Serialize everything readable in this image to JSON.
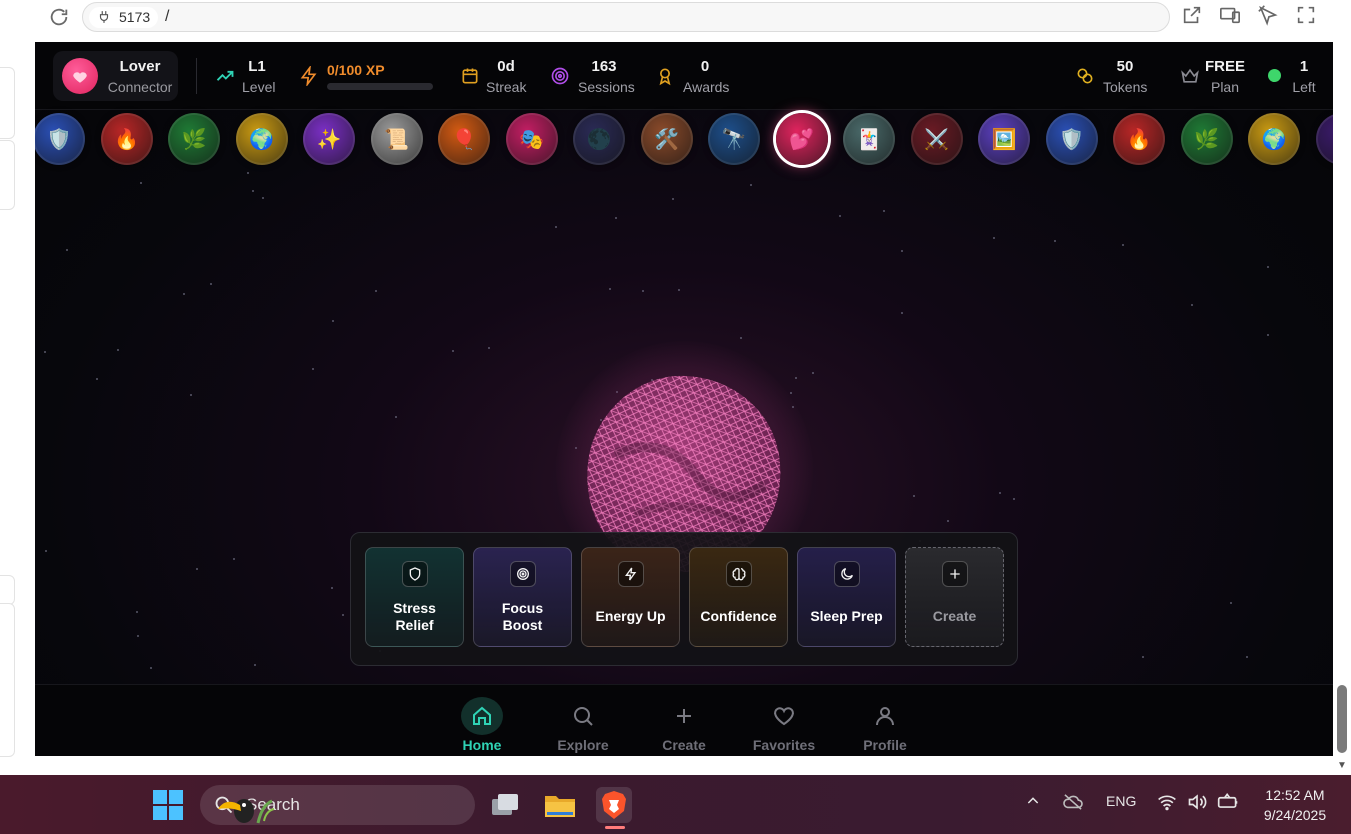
{
  "browser": {
    "port_chip": "5173",
    "path": "/"
  },
  "topstats": {
    "profile": {
      "name": "Lover",
      "role": "Connector"
    },
    "level": {
      "value": "L1",
      "label": "Level"
    },
    "xp": {
      "text": "0/100 XP",
      "progress": 0
    },
    "streak": {
      "value": "0d",
      "label": "Streak"
    },
    "sessions": {
      "value": "163",
      "label": "Sessions"
    },
    "awards": {
      "value": "0",
      "label": "Awards"
    },
    "tokens": {
      "value": "50",
      "label": "Tokens"
    },
    "plan": {
      "value": "FREE",
      "label": "Plan"
    },
    "left": {
      "value": "1",
      "label": "Left"
    }
  },
  "badges": [
    {
      "icon": "🛡️",
      "color": "#2a4fb5"
    },
    {
      "icon": "🔥",
      "color": "#b82626"
    },
    {
      "icon": "🌿",
      "color": "#1f7a35"
    },
    {
      "icon": "🌍",
      "color": "#c99a12"
    },
    {
      "icon": "✨",
      "color": "#7a2fc4"
    },
    {
      "icon": "📜",
      "color": "#9a9a9a"
    },
    {
      "icon": "🎈",
      "color": "#d35a12"
    },
    {
      "icon": "🎭",
      "color": "#c21e63"
    },
    {
      "icon": "🌑",
      "color": "#2a2a55"
    },
    {
      "icon": "🛠️",
      "color": "#8a4a2a"
    },
    {
      "icon": "🔭",
      "color": "#1d4e8a"
    },
    {
      "icon": "💕",
      "color": "#e0245e",
      "active": true
    },
    {
      "icon": "🃏",
      "color": "#4a6a6a"
    },
    {
      "icon": "⚔️",
      "color": "#6a1a24"
    },
    {
      "icon": "🖼️",
      "color": "#5b3fbf"
    },
    {
      "icon": "🛡️",
      "color": "#2a4fb5"
    },
    {
      "icon": "🔥",
      "color": "#b82626"
    },
    {
      "icon": "🌿",
      "color": "#1f7a35"
    },
    {
      "icon": "🌍",
      "color": "#c99a12"
    },
    {
      "icon": "",
      "color": "#3a1a6a"
    }
  ],
  "quick_actions": [
    {
      "label": "Stress Relief",
      "icon": "shield-icon",
      "bg": "#123232"
    },
    {
      "label": "Focus Boost",
      "icon": "target-icon",
      "bg": "#2a2350"
    },
    {
      "label": "Energy Up",
      "icon": "bolt-icon",
      "bg": "#3b2418"
    },
    {
      "label": "Confidence",
      "icon": "brain-icon",
      "bg": "#3a2812"
    },
    {
      "label": "Sleep Prep",
      "icon": "moon-icon",
      "bg": "#251f4a"
    },
    {
      "label": "Create",
      "icon": "plus-icon",
      "bg": "#2a2a2e"
    }
  ],
  "nav": [
    {
      "label": "Home",
      "active": true
    },
    {
      "label": "Explore"
    },
    {
      "label": "Create"
    },
    {
      "label": "Favorites"
    },
    {
      "label": "Profile"
    }
  ],
  "taskbar": {
    "search_placeholder": "Search",
    "language": "ENG",
    "time": "12:52 AM",
    "date": "9/24/2025"
  },
  "colors": {
    "accent": "#2fd3b5",
    "xp": "#f08c2c",
    "brand_pink": "#e0245e",
    "status_green": "#3ed66b"
  }
}
